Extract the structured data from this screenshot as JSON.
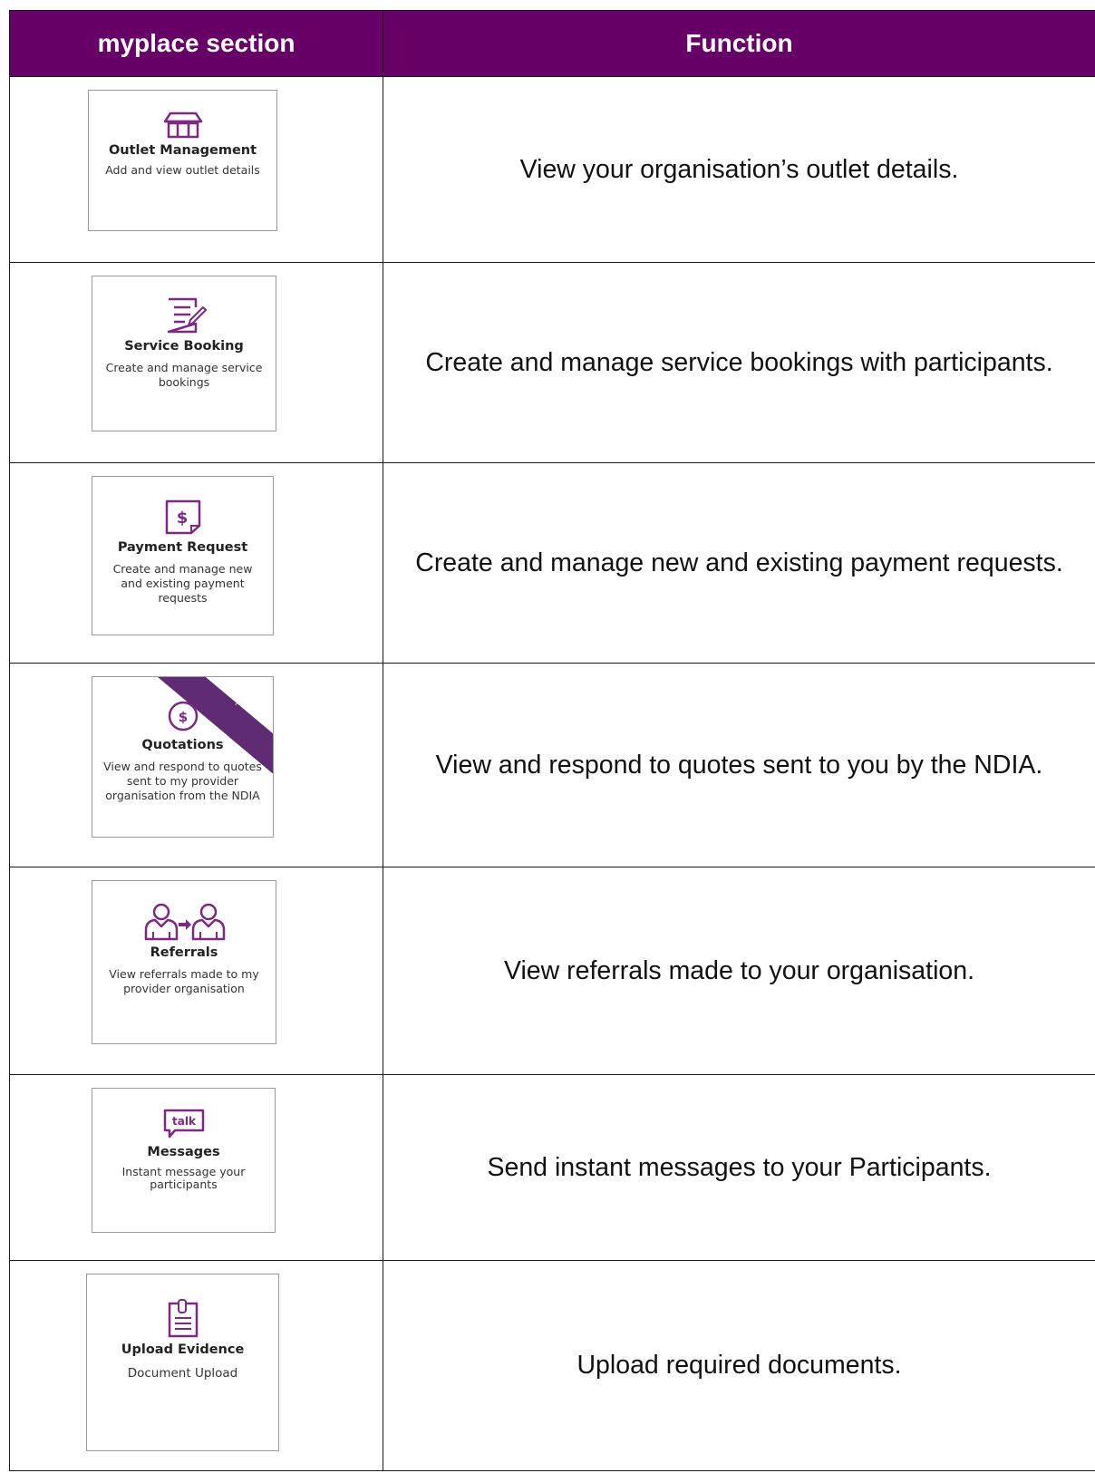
{
  "table": {
    "headers": {
      "section": "myplace section",
      "function": "Function"
    },
    "rows": [
      {
        "tile_title": "Outlet Management",
        "tile_description": "Add and view outlet details",
        "icon": "storefront-icon",
        "function": "View your organisation’s outlet details."
      },
      {
        "tile_title": "Service Booking",
        "tile_description": "Create and manage service bookings",
        "icon": "document-edit-icon",
        "function": "Create and manage service bookings with participants."
      },
      {
        "tile_title": "Payment Request",
        "tile_description": "Create and manage new and existing payment requests",
        "icon": "dollar-document-icon",
        "function": "Create and manage new and existing payment requests."
      },
      {
        "tile_title": "Quotations",
        "tile_description": "View and respond to quotes sent to my provider organisation from the NDIA",
        "icon": "dollar-circle-icon",
        "function": "View and respond to quotes sent to you by the NDIA."
      },
      {
        "tile_title": "Referrals",
        "tile_description": "View referrals made to my provider organisation",
        "icon": "people-referral-icon",
        "function": "View referrals made to your organisation."
      },
      {
        "tile_title": "Messages",
        "tile_description": "Instant message your participants",
        "icon": "talk-bubble-icon",
        "icon_text": "talk",
        "function": "Send instant messages to your Participants."
      },
      {
        "tile_title": "Upload Evidence",
        "tile_description": "Document Upload",
        "icon": "clipboard-icon",
        "function": "Upload required documents."
      }
    ]
  },
  "colors": {
    "header_bg": "#660066",
    "header_text": "#ffffff",
    "icon_purple": "#7a2a80",
    "ribbon": "#5f2c73"
  }
}
